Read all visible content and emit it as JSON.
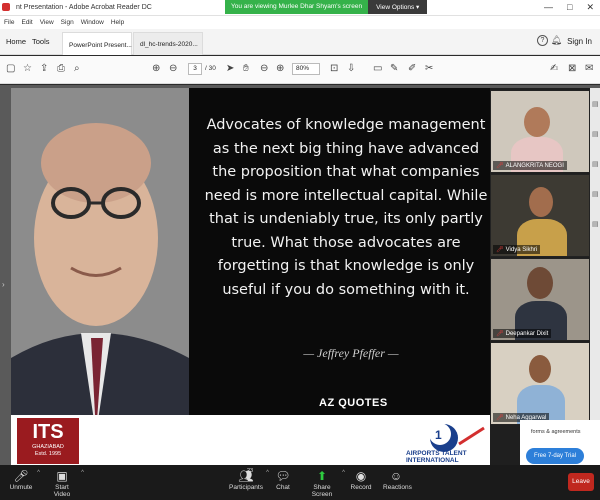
{
  "window": {
    "title": "nt Presentation - Adobe Acrobat Reader DC",
    "controls": [
      "—",
      "□",
      "✕"
    ]
  },
  "zoom_share": {
    "message": "You are viewing Murlee Dhar Shyam's screen",
    "options_label": "View Options ▾"
  },
  "menu": [
    "File",
    "Edit",
    "View",
    "Sign",
    "Window",
    "Help"
  ],
  "tabs": {
    "home": "Home",
    "tools": "Tools",
    "doc_tabs": [
      {
        "label": "PowerPoint Present...",
        "active": true
      },
      {
        "label": "dl_hc-trends-2020...",
        "active": false
      }
    ],
    "help": "?",
    "sign_in": "Sign In"
  },
  "toolbar": {
    "page_current": "3",
    "page_total": "/ 30",
    "zoom": "80%"
  },
  "slide": {
    "quote": "Advocates of knowledge management as the next big thing have advanced the proposition that what companies need is more intellectual capital. While that is undeniably true, its only partly true. What those advocates are forgetting is that knowledge is only useful if you do something with it.",
    "author": "— Jeffrey Pfeffer —",
    "brand": "AZ QUOTES",
    "its_logo": "ITS",
    "its_subtitle": "GHAZIABAD",
    "its_estd": "Estd. 1995",
    "airports_text": "AIRPORTS TALENT\nINTERNATIONAL"
  },
  "participants": [
    {
      "name": "ALANGKRITA NEOGI",
      "muted": true
    },
    {
      "name": "Vidya Sikhri",
      "muted": true
    },
    {
      "name": "Deepankar Dixit",
      "muted": true
    },
    {
      "name": "Neha Aggarwal",
      "muted": true
    }
  ],
  "web_panel": {
    "link_text": "forms & agreements",
    "button": "Free 7-day Trial"
  },
  "zoom_bar": {
    "unmute": "Unmute",
    "start_video": "Start Video",
    "participants": "Participants",
    "participant_count": "23",
    "chat": "Chat",
    "share_screen": "Share Screen",
    "record": "Record",
    "reactions": "Reactions",
    "leave": "Leave"
  },
  "colors": {
    "zoom_green": "#35b24a",
    "leave_red": "#c0281f",
    "its_red": "#9a1b1f",
    "trial_blue": "#2d7fd9"
  }
}
